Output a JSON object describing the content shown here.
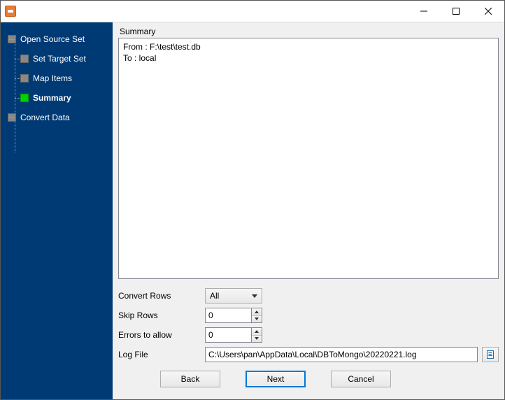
{
  "sidebar": {
    "items": [
      {
        "label": "Open Source Set",
        "indent": "top",
        "active": false
      },
      {
        "label": "Set Target Set",
        "indent": "child",
        "active": false
      },
      {
        "label": "Map Items",
        "indent": "child",
        "active": false
      },
      {
        "label": "Summary",
        "indent": "child",
        "active": true
      },
      {
        "label": "Convert Data",
        "indent": "top",
        "active": false
      }
    ]
  },
  "main": {
    "section_label": "Summary",
    "summary_text": "From : F:\\test\\test.db\nTo : local",
    "form": {
      "convert_rows": {
        "label": "Convert Rows",
        "value": "All"
      },
      "skip_rows": {
        "label": "Skip Rows",
        "value": "0"
      },
      "errors_allow": {
        "label": "Errors to allow",
        "value": "0"
      },
      "log_file": {
        "label": "Log File",
        "value": "C:\\Users\\pan\\AppData\\Local\\DBToMongo\\20220221.log"
      }
    }
  },
  "buttons": {
    "back": "Back",
    "next": "Next",
    "cancel": "Cancel"
  }
}
